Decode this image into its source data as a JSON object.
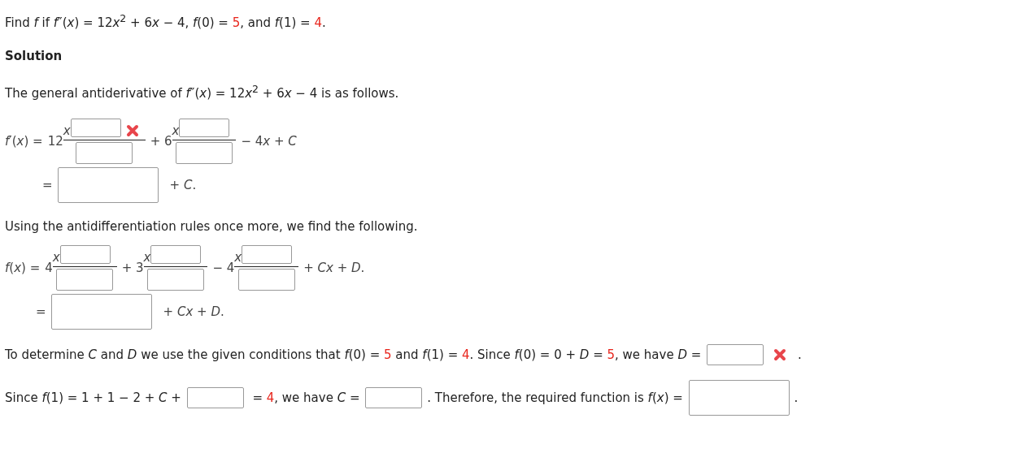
{
  "problem": [
    {
      "kind": "plain",
      "text": "Find *f* if *f*″(*x*) = 12"
    },
    {
      "kind": "var",
      "text": "x"
    },
    {
      "kind": "plain",
      "text": "$^{2}$ + 6"
    },
    {
      "kind": "var",
      "text": "x"
    },
    {
      "kind": "plain",
      "text": " − 4, *f*(0) = "
    },
    {
      "kind": "given",
      "text": "5"
    },
    {
      "kind": "plain",
      "text": ", and *f*(1) = "
    },
    {
      "kind": "given",
      "text": "4"
    },
    {
      "kind": "plain",
      "text": "."
    }
  ],
  "heading": "Solution",
  "intro": [
    {
      "kind": "plain",
      "text": "The general antiderivative of *f*″(*x*) = 12"
    },
    {
      "kind": "var",
      "text": "x"
    },
    {
      "kind": "plain",
      "text": "$^{2}$ + 6"
    },
    {
      "kind": "var",
      "text": "x"
    },
    {
      "kind": "plain",
      "text": " − 4 is as follows."
    }
  ],
  "derivative": {
    "lhs": "*f*′(*x*) =",
    "terms": [
      {
        "kind": "fraction",
        "lead": "12",
        "base": "x",
        "incorrect": true
      },
      {
        "kind": "fraction",
        "lead": "+ 6",
        "base": "x",
        "incorrect": false
      },
      {
        "kind": "text",
        "segments": [
          {
            "kind": "plain",
            "text": "− 4"
          },
          {
            "kind": "var",
            "text": "x"
          },
          {
            "kind": "plain",
            "text": " + *C*"
          }
        ]
      }
    ],
    "result": {
      "eq": "=",
      "tail": "+ *C*."
    }
  },
  "middle": "Using the antidifferentiation rules once more, we find the following.",
  "function": {
    "lhs": "*f*(*x*) =",
    "terms": [
      {
        "kind": "fraction",
        "lead": "4",
        "base": "x",
        "incorrect": false
      },
      {
        "kind": "fraction",
        "lead": "+ 3",
        "base": "x",
        "incorrect": false
      },
      {
        "kind": "fraction",
        "lead": "− 4",
        "base": "x",
        "incorrect": false
      },
      {
        "kind": "text",
        "segments": [
          {
            "kind": "plain",
            "text": "+ *Cx* + *D*."
          }
        ]
      }
    ],
    "result": {
      "eq": "=",
      "tail": "+ *Cx* + *D*."
    }
  },
  "conditions": [
    [
      {
        "kind": "plain",
        "text": "To determine *C* and *D* we use the given conditions that *f*(0) = "
      },
      {
        "kind": "given",
        "text": "5"
      },
      {
        "kind": "plain",
        "text": " and *f*(1) = "
      },
      {
        "kind": "given",
        "text": "4"
      },
      {
        "kind": "plain",
        "text": ". Since *f*(0) = 0 + *D* = "
      },
      {
        "kind": "given",
        "text": "5"
      },
      {
        "kind": "plain",
        "text": ", we have *D* = "
      },
      {
        "kind": "field",
        "incorrect": true
      },
      {
        "kind": "plain",
        "text": "."
      }
    ],
    [
      {
        "kind": "plain",
        "text": "Since *f*(1) = 1 + 1 − 2 + *C* + "
      },
      {
        "kind": "field",
        "incorrect": false
      },
      {
        "kind": "plain",
        "text": " = "
      },
      {
        "kind": "given",
        "text": "4"
      },
      {
        "kind": "plain",
        "text": ", we have *C* = "
      },
      {
        "kind": "field",
        "incorrect": false
      },
      {
        "kind": "plain",
        "text": ". Therefore, the required function is *f*(*x*) = "
      },
      {
        "kind": "wide_field",
        "incorrect": false
      },
      {
        "kind": "plain",
        "text": "."
      }
    ]
  ]
}
